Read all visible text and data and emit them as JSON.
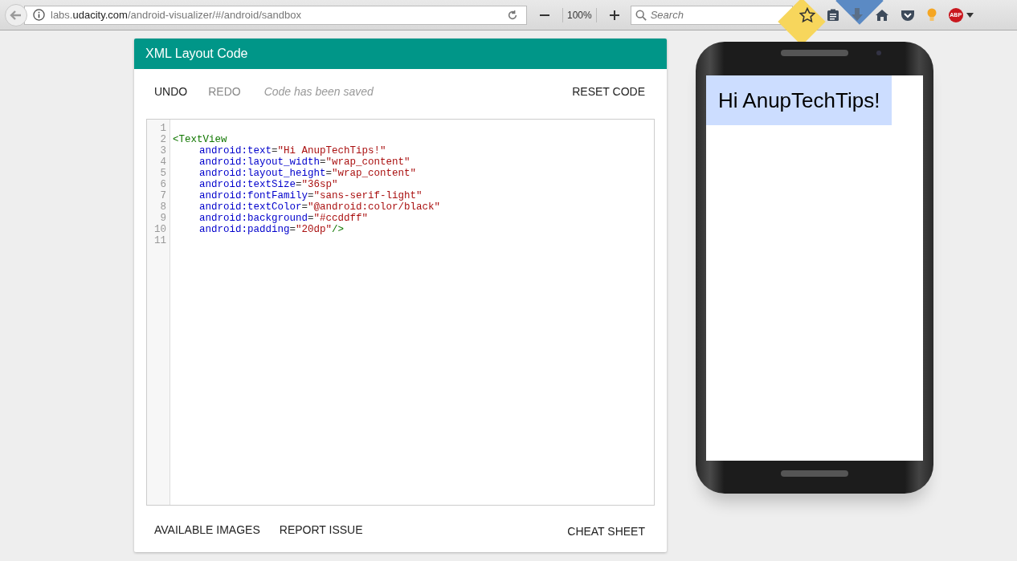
{
  "browser": {
    "url": [
      {
        "text": "labs.",
        "emphasis": false
      },
      {
        "text": "udacity.com",
        "emphasis": true
      },
      {
        "text": "/android-visualizer/#/android/sandbox",
        "emphasis": false
      }
    ],
    "zoom": "100%",
    "search": {
      "placeholder": "Search"
    },
    "adblock_label": "ABP"
  },
  "editor": {
    "title": "XML Layout Code",
    "actions": [
      {
        "label": "UNDO",
        "disabled": false
      },
      {
        "label": "REDO",
        "disabled": true
      }
    ],
    "status": "Code has been saved",
    "reset": "RESET CODE",
    "lines": [
      {
        "number": "1",
        "indented": false
      },
      {
        "number": "2",
        "indented": false,
        "tokens": [
          {
            "kind": "tag",
            "text": "<TextView"
          }
        ]
      },
      {
        "number": "3",
        "indented": true,
        "tokens": [
          {
            "kind": "attr",
            "text": "android:text"
          },
          {
            "kind": "punct",
            "text": "="
          },
          {
            "kind": "string",
            "text": "\"Hi AnupTechTips!\""
          }
        ]
      },
      {
        "number": "4",
        "indented": true,
        "tokens": [
          {
            "kind": "attr",
            "text": "android:layout_width"
          },
          {
            "kind": "punct",
            "text": "="
          },
          {
            "kind": "string",
            "text": "\"wrap_content\""
          }
        ]
      },
      {
        "number": "5",
        "indented": true,
        "tokens": [
          {
            "kind": "attr",
            "text": "android:layout_height"
          },
          {
            "kind": "punct",
            "text": "="
          },
          {
            "kind": "string",
            "text": "\"wrap_content\""
          }
        ]
      },
      {
        "number": "6",
        "indented": true,
        "tokens": [
          {
            "kind": "attr",
            "text": "android:textSize"
          },
          {
            "kind": "punct",
            "text": "="
          },
          {
            "kind": "string",
            "text": "\"36sp\""
          }
        ]
      },
      {
        "number": "7",
        "indented": true,
        "tokens": [
          {
            "kind": "attr",
            "text": "android:fontFamily"
          },
          {
            "kind": "punct",
            "text": "="
          },
          {
            "kind": "string",
            "text": "\"sans-serif-light\""
          }
        ]
      },
      {
        "number": "8",
        "indented": true,
        "tokens": [
          {
            "kind": "attr",
            "text": "android:textColor"
          },
          {
            "kind": "punct",
            "text": "="
          },
          {
            "kind": "string",
            "text": "\"@android:color/black\""
          }
        ]
      },
      {
        "number": "9",
        "indented": true,
        "tokens": [
          {
            "kind": "attr",
            "text": "android:background"
          },
          {
            "kind": "punct",
            "text": "="
          },
          {
            "kind": "string",
            "text": "\"#ccddff\""
          }
        ]
      },
      {
        "number": "10",
        "indented": true,
        "tokens": [
          {
            "kind": "attr",
            "text": "android:padding"
          },
          {
            "kind": "punct",
            "text": "="
          },
          {
            "kind": "string",
            "text": "\"20dp\""
          },
          {
            "kind": "tag",
            "text": "/>"
          }
        ]
      },
      {
        "number": "11",
        "indented": false
      }
    ],
    "footer_links": [
      "AVAILABLE IMAGES",
      "REPORT ISSUE"
    ],
    "cheat_sheet": "CHEAT SHEET"
  },
  "preview": {
    "text": "Hi AnupTechTips!"
  }
}
